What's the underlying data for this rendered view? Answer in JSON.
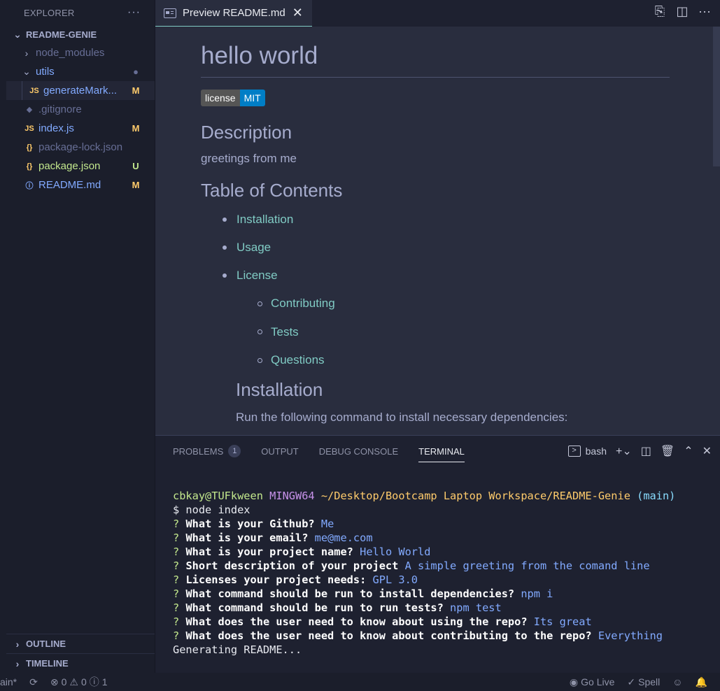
{
  "sidebar": {
    "explorer_title": "EXPLORER",
    "more_icon": "...",
    "project_name": "README-GENIE",
    "items": [
      {
        "name": "node_modules",
        "type": "folder",
        "color": "#676e95"
      },
      {
        "name": "utils",
        "type": "folder-open",
        "color": "#82aaff",
        "badge": "●",
        "badge_color": "#676e95"
      },
      {
        "name": "generateMark...",
        "type": "js",
        "icon": "JS",
        "color": "#82aaff",
        "badge": "M",
        "badge_color": "#ffcb6b"
      },
      {
        "name": ".gitignore",
        "type": "git",
        "icon": "◆",
        "color": "#676e95"
      },
      {
        "name": "index.js",
        "type": "js",
        "icon": "JS",
        "color": "#82aaff",
        "badge": "M",
        "badge_color": "#ffcb6b"
      },
      {
        "name": "package-lock.json",
        "type": "json",
        "icon": "{}",
        "color": "#676e95"
      },
      {
        "name": "package.json",
        "type": "json",
        "icon": "{}",
        "color": "#c3e88d",
        "badge": "U",
        "badge_color": "#c3e88d"
      },
      {
        "name": "README.md",
        "type": "info",
        "icon": "ⓘ",
        "color": "#82aaff",
        "badge": "M",
        "badge_color": "#ffcb6b"
      }
    ],
    "outline_label": "OUTLINE",
    "timeline_label": "TIMELINE"
  },
  "editor": {
    "tab_label": "Preview README.md",
    "tab_close": "✕"
  },
  "preview": {
    "title": "hello world",
    "badge_left": "license",
    "badge_right": "MIT",
    "description_heading": "Description",
    "description_text": "greetings from me",
    "toc_heading": "Table of Contents",
    "toc_items": [
      "Installation",
      "Usage",
      "License"
    ],
    "toc_subitems": [
      "Contributing",
      "Tests",
      "Questions"
    ],
    "installation_heading": "Installation",
    "installation_text": "Run the following command to install necessary dependencies:"
  },
  "panel": {
    "tabs": [
      "PROBLEMS",
      "OUTPUT",
      "DEBUG CONSOLE",
      "TERMINAL"
    ],
    "problems_count": "1",
    "shell_label": "bash"
  },
  "terminal": {
    "prompt_user": "cbkay@TUFkween",
    "prompt_env": "MINGW64",
    "prompt_path": "~/Desktop/Bootcamp Laptop Workspace/README-Genie",
    "prompt_branch": "(main)",
    "command": "$ node index",
    "qa": [
      {
        "q": "What is your Github?",
        "a": "Me"
      },
      {
        "q": "What is your email?",
        "a": "me@me.com"
      },
      {
        "q": "What is your project name?",
        "a": "Hello World"
      },
      {
        "q": "Short description of your project",
        "a": "A simple greeting from the comand line"
      },
      {
        "q": "Licenses your project needs:",
        "a": "GPL 3.0"
      },
      {
        "q": "What command should be run to install dependencies?",
        "a": "npm i"
      },
      {
        "q": "What command should be run to run tests?",
        "a": "npm test"
      },
      {
        "q": "What does the user need to know about using the repo?",
        "a": "Its great"
      },
      {
        "q": "What does the user need to know about contributing to the repo?",
        "a": "Everything"
      }
    ],
    "last_line": "Generating README..."
  },
  "statusbar": {
    "branch": "ain*",
    "errors": "0",
    "warnings": "0",
    "info": "1",
    "go_live": "Go Live",
    "spell": "Spell"
  }
}
